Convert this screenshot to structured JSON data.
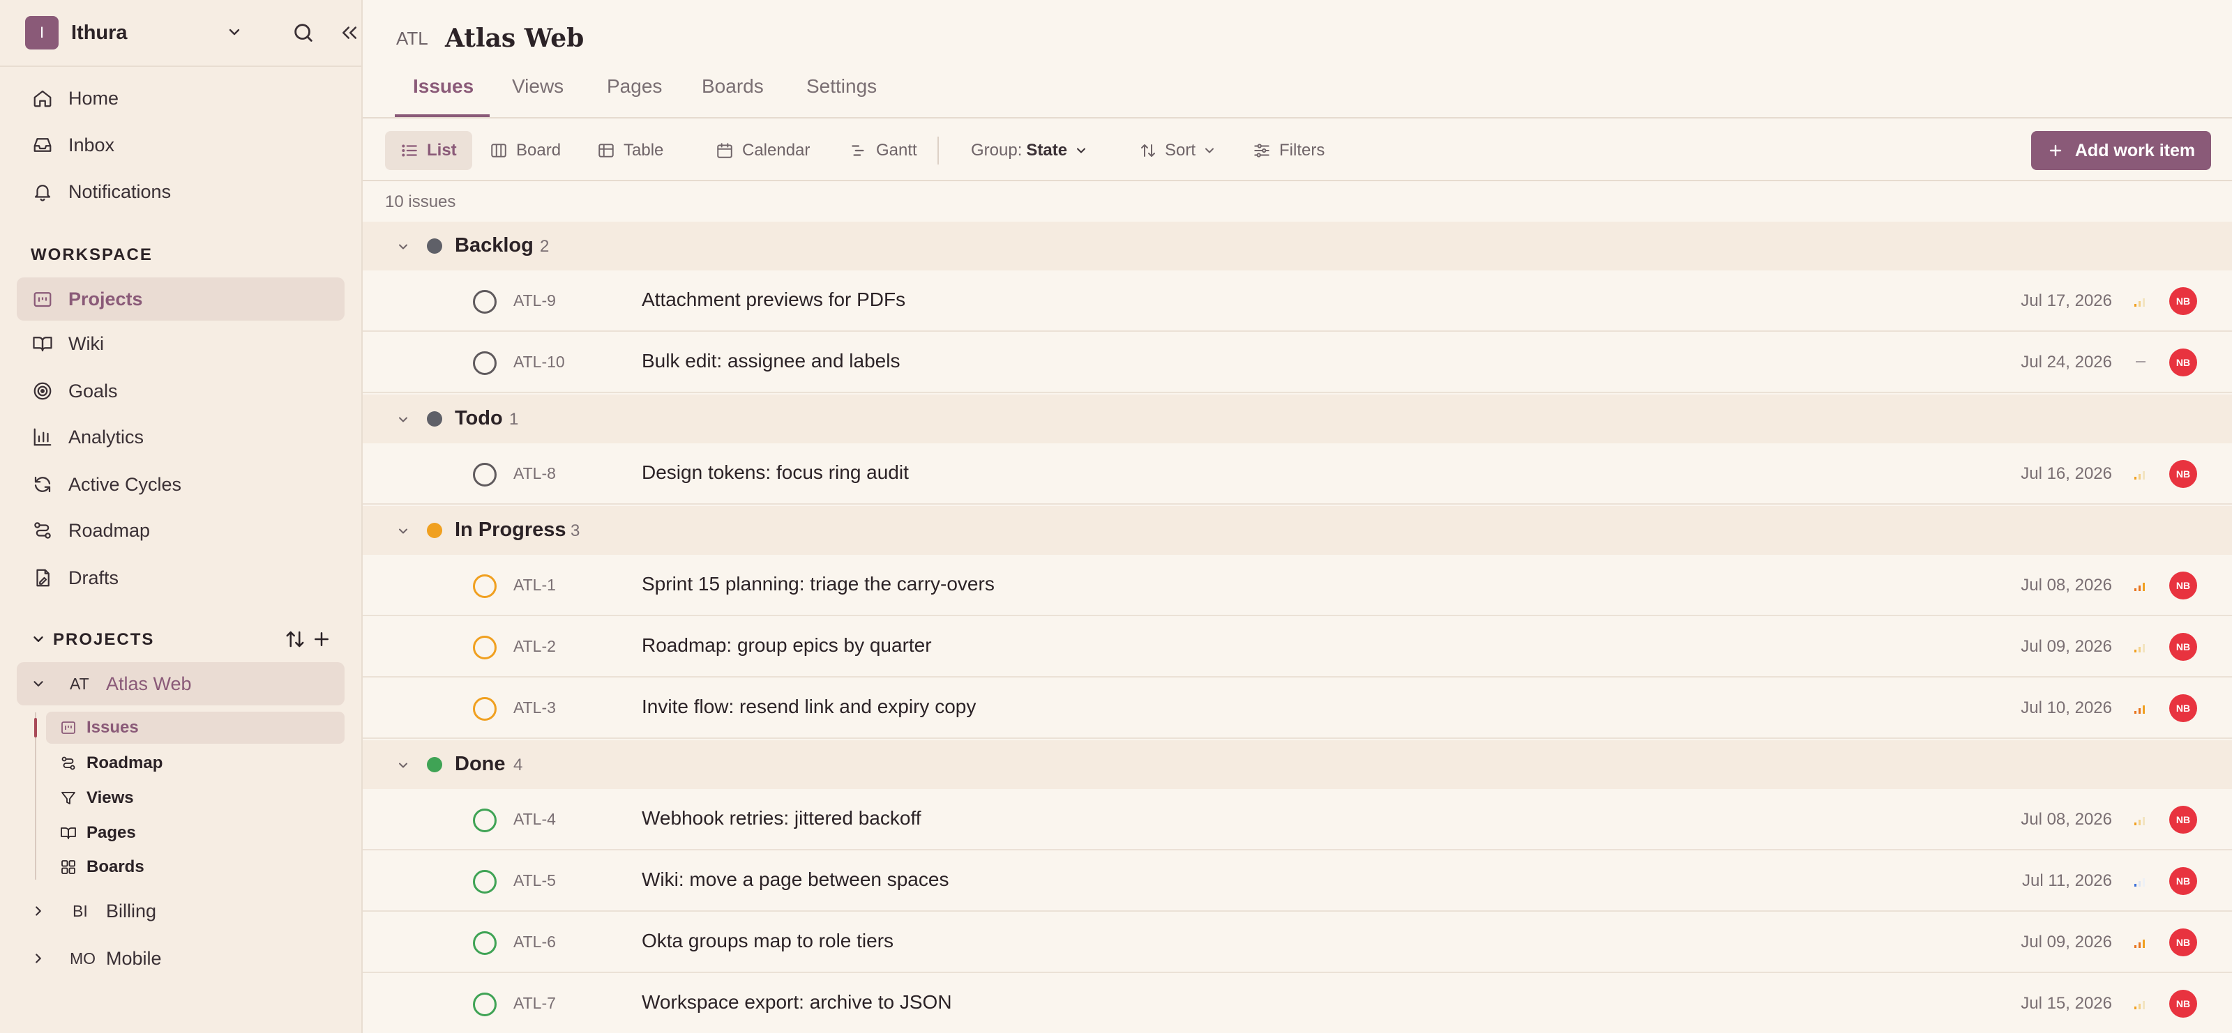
{
  "workspace": {
    "logo_letter": "I",
    "name": "Ithura"
  },
  "nav": {
    "home": "Home",
    "inbox": "Inbox",
    "notifications": "Notifications"
  },
  "workspace_section": {
    "title": "WORKSPACE",
    "items": [
      "Projects",
      "Wiki",
      "Goals",
      "Analytics",
      "Active Cycles",
      "Roadmap",
      "Drafts"
    ]
  },
  "projects_section": {
    "title": "PROJECTS",
    "projects": [
      {
        "code": "AT",
        "name": "Atlas Web"
      },
      {
        "code": "BI",
        "name": "Billing"
      },
      {
        "code": "MO",
        "name": "Mobile"
      }
    ],
    "atlas_subitems": [
      "Issues",
      "Roadmap",
      "Views",
      "Pages",
      "Boards"
    ]
  },
  "header": {
    "prefix": "ATL",
    "title": "Atlas Web",
    "tabs": [
      "Issues",
      "Views",
      "Pages",
      "Boards",
      "Settings"
    ]
  },
  "toolbar": {
    "layouts": [
      "List",
      "Board",
      "Table",
      "Calendar",
      "Gantt"
    ],
    "group_label": "Group:",
    "group_value": "State",
    "sort": "Sort",
    "filters": "Filters",
    "add_button": "Add work item"
  },
  "issue_count": "10 issues",
  "colors": {
    "accent": "#8a5a78",
    "backlog": "#5f6068",
    "todo": "#5f6068",
    "in_progress": "#f0a020",
    "done": "#3fa355",
    "avatar": "#e8333f"
  },
  "groups": [
    {
      "name": "Backlog",
      "count": "2"
    },
    {
      "name": "Todo",
      "count": "1"
    },
    {
      "name": "In Progress",
      "count": "3"
    },
    {
      "name": "Done",
      "count": "4"
    }
  ],
  "issues": [
    {
      "id": "ATL-9",
      "title": "Attachment previews for PDFs",
      "date": "Jul 17, 2026",
      "priority": "low",
      "assignee": "NB"
    },
    {
      "id": "ATL-10",
      "title": "Bulk edit: assignee and labels",
      "date": "Jul 24, 2026",
      "priority": "none",
      "assignee": "NB"
    },
    {
      "id": "ATL-8",
      "title": "Design tokens: focus ring audit",
      "date": "Jul 16, 2026",
      "priority": "low",
      "assignee": "NB"
    },
    {
      "id": "ATL-1",
      "title": "Sprint 15 planning: triage the carry-overs",
      "date": "Jul 08, 2026",
      "priority": "high",
      "assignee": "NB"
    },
    {
      "id": "ATL-2",
      "title": "Roadmap: group epics by quarter",
      "date": "Jul 09, 2026",
      "priority": "low",
      "assignee": "NB"
    },
    {
      "id": "ATL-3",
      "title": "Invite flow: resend link and expiry copy",
      "date": "Jul 10, 2026",
      "priority": "high",
      "assignee": "NB"
    },
    {
      "id": "ATL-4",
      "title": "Webhook retries: jittered backoff",
      "date": "Jul 08, 2026",
      "priority": "low",
      "assignee": "NB"
    },
    {
      "id": "ATL-5",
      "title": "Wiki: move a page between spaces",
      "date": "Jul 11, 2026",
      "priority": "low-blue",
      "assignee": "NB"
    },
    {
      "id": "ATL-6",
      "title": "Okta groups map to role tiers",
      "date": "Jul 09, 2026",
      "priority": "high",
      "assignee": "NB"
    },
    {
      "id": "ATL-7",
      "title": "Workspace export: archive to JSON",
      "date": "Jul 15, 2026",
      "priority": "low",
      "assignee": "NB"
    }
  ]
}
